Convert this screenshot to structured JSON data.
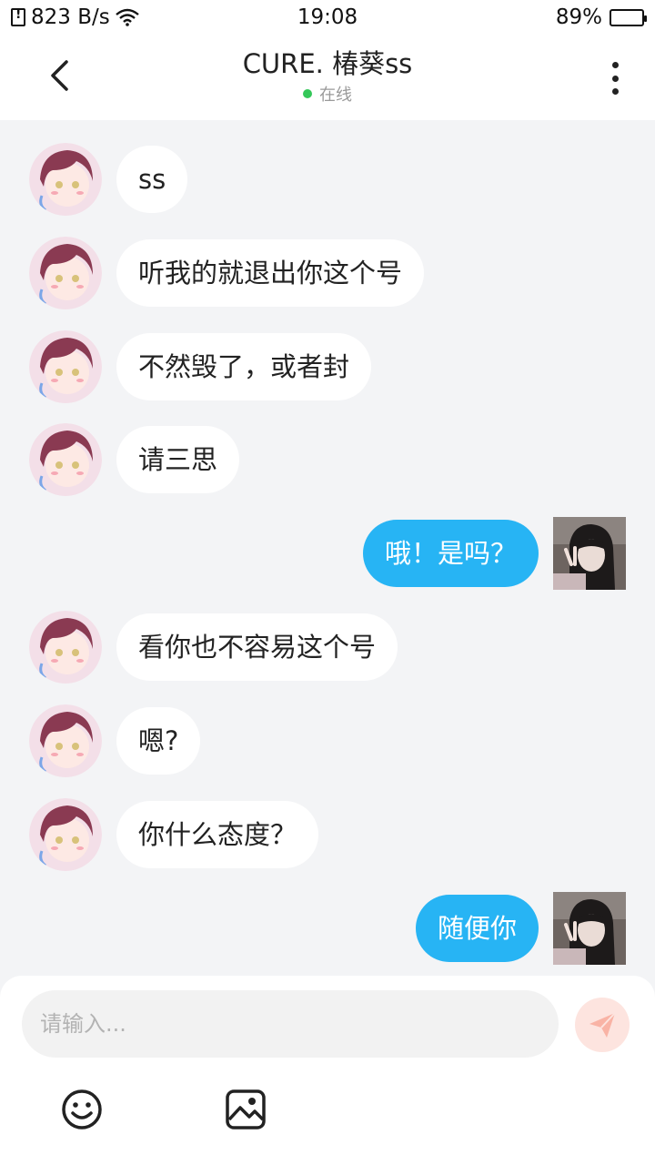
{
  "status_bar": {
    "speed": "823 B/s",
    "time": "19:08",
    "battery": "89%",
    "battery_level": 0.89
  },
  "header": {
    "title": "CURE. 椿葵ss",
    "status": "在线"
  },
  "messages": [
    {
      "side": "in",
      "text": "ss"
    },
    {
      "side": "in",
      "text": "听我的就退出你这个号"
    },
    {
      "side": "in",
      "text": "不然毁了，或者封"
    },
    {
      "side": "in",
      "text": "请三思"
    },
    {
      "side": "out",
      "text": "哦！是吗？"
    },
    {
      "side": "in",
      "text": "看你也不容易这个号"
    },
    {
      "side": "in",
      "text": "嗯?"
    },
    {
      "side": "in",
      "text": "你什么态度？"
    },
    {
      "side": "out",
      "text": "随便你"
    }
  ],
  "input": {
    "placeholder": "请输入..."
  },
  "icons": {
    "back": "back-arrow-icon",
    "more": "more-vertical-icon",
    "send": "send-icon",
    "emoji": "emoji-icon",
    "image": "image-icon"
  },
  "colors": {
    "outgoing_bubble": "#27b4f4",
    "incoming_bubble": "#ffffff",
    "online_dot": "#34c759",
    "send_button": "#fde4df"
  }
}
